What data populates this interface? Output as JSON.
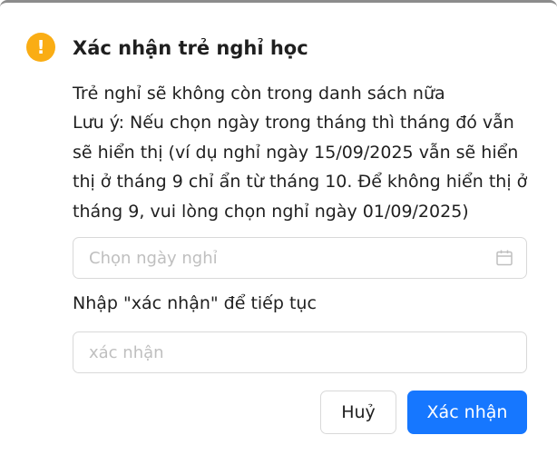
{
  "dialog": {
    "title": "Xác nhận trẻ nghỉ học",
    "icon": "exclamation-icon",
    "icon_glyph": "!",
    "icon_color": "#faad14",
    "message_lines": [
      "Trẻ nghỉ sẽ không còn trong danh sách nữa",
      "Lưu ý: Nếu chọn ngày trong tháng thì tháng đó vẫn",
      "sẽ hiển thị (ví dụ nghỉ ngày 15/09/2025 vẫn sẽ hiển",
      "thị ở tháng 9 chỉ ẩn từ tháng 10. Để không hiển thị ở",
      "tháng 9, vui lòng chọn nghỉ ngày 01/09/2025)"
    ],
    "date_picker": {
      "placeholder": "Chọn ngày nghỉ",
      "value": "",
      "icon": "calendar-icon"
    },
    "confirm_label": "Nhập \"xác nhận\" để tiếp tục",
    "confirm_input": {
      "placeholder": "xác nhận",
      "value": ""
    },
    "buttons": {
      "cancel_label": "Huỷ",
      "ok_label": "Xác nhận"
    },
    "primary_color": "#1677ff"
  }
}
